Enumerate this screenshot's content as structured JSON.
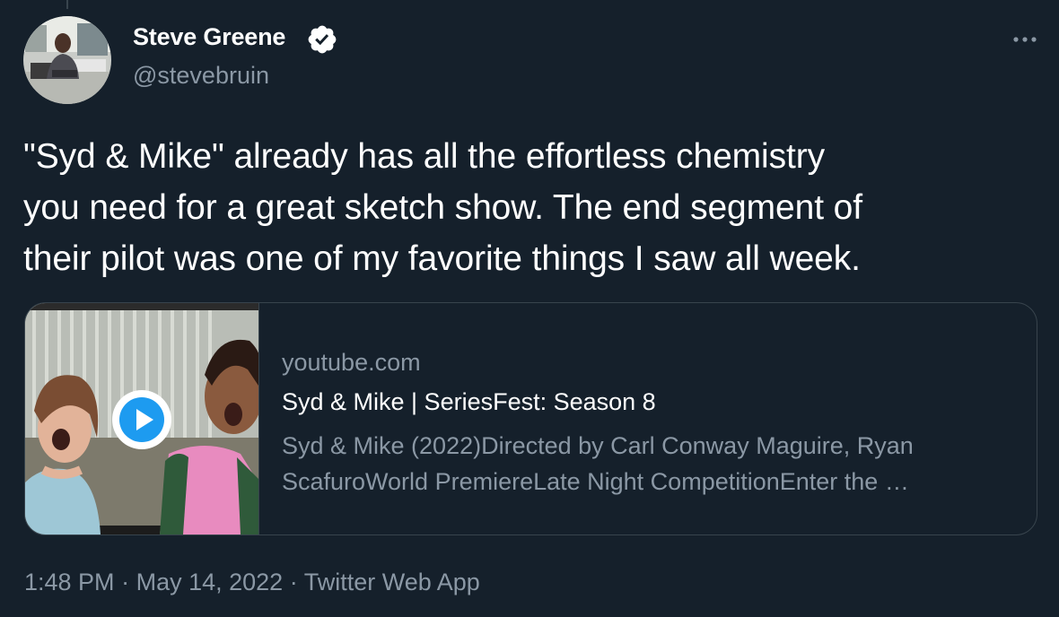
{
  "tweet": {
    "author": {
      "name": "Steve Greene",
      "handle": "@stevebruin",
      "verified": true
    },
    "text_lines": [
      "\"Syd & Mike\" already has all the effortless chemistry",
      "you need for a great sketch show. The end segment of",
      "their pilot was one of my favorite things I saw all week."
    ],
    "card": {
      "domain": "youtube.com",
      "title": "Syd & Mike | SeriesFest: Season 8",
      "description_lines": [
        "Syd & Mike (2022)Directed by Carl Conway Maguire, Ryan",
        "ScafuroWorld PremiereLate Night CompetitionEnter the …"
      ],
      "media_icon": "play-icon"
    },
    "meta": {
      "time": "1:48 PM",
      "separator": "·",
      "date": "May 14, 2022",
      "source": "Twitter Web App"
    }
  },
  "icons": {
    "more": "more-horizontal-icon",
    "verified": "verified-badge-icon"
  },
  "colors": {
    "background": "#15202b",
    "primary_text": "#ffffff",
    "secondary_text": "#8b98a5",
    "border": "#38444d",
    "accent": "#1d9bf0"
  }
}
